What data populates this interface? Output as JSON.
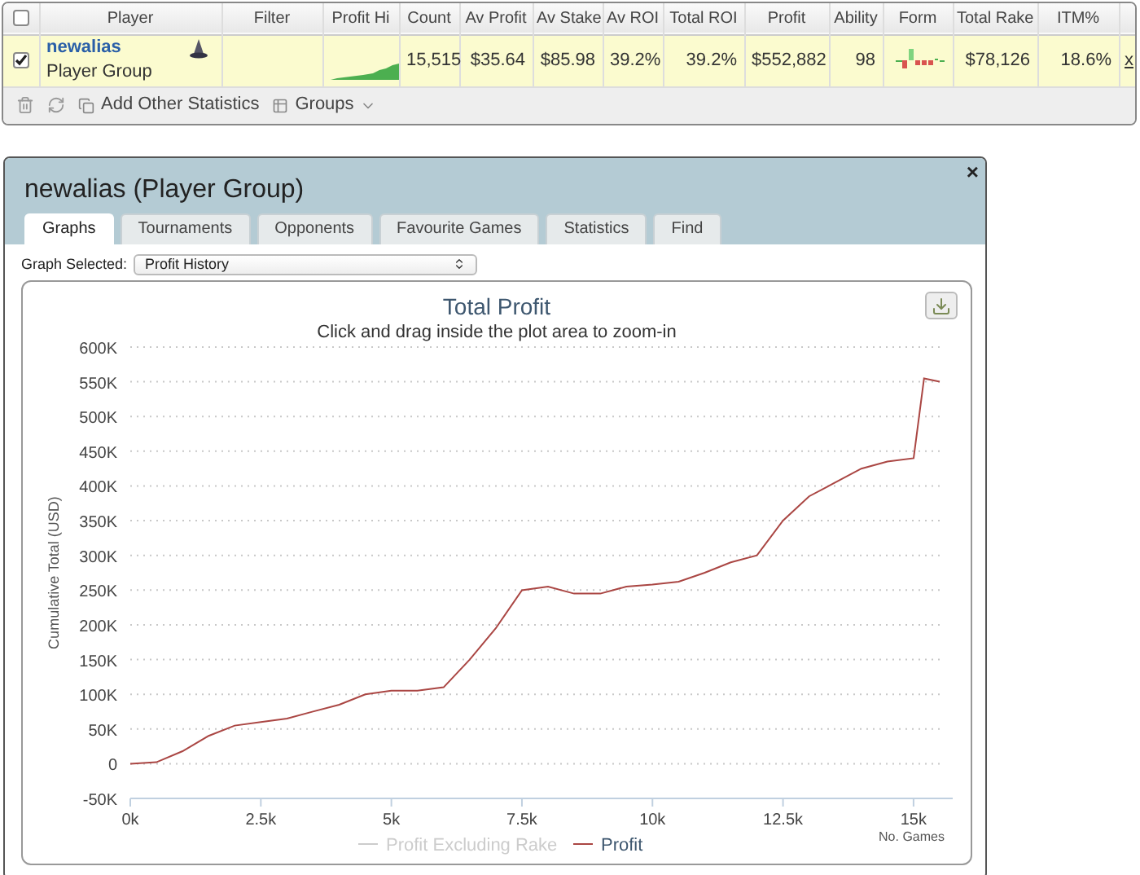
{
  "table": {
    "select_all": {
      "checked": false
    },
    "columns": [
      {},
      {
        "label": "Player"
      },
      {
        "label": "Filter"
      },
      {
        "label": "Profit Hi"
      },
      {
        "label": "Count"
      },
      {
        "label": "Av Profit"
      },
      {
        "label": "Av Stake"
      },
      {
        "label": "Av ROI"
      },
      {
        "label": "Total ROI"
      },
      {
        "label": "Profit"
      },
      {
        "label": "Ability"
      },
      {
        "label": "Form"
      },
      {
        "label": "Total Rake"
      },
      {
        "label": "ITM%"
      },
      {}
    ],
    "rows": [
      {
        "checked": true,
        "name": "newalias",
        "subtitle": "Player Group",
        "count": "15,515",
        "av_profit": "$35.64",
        "av_stake": "$85.98",
        "av_roi": "39.2%",
        "total_roi": "39.2%",
        "profit": "$552,882",
        "ability": "98",
        "total_rake": "$78,126",
        "itm": "18.6%",
        "remove": "x"
      }
    ]
  },
  "toolbar": {
    "items": [
      {
        "kind": "trash"
      },
      {
        "kind": "refresh"
      },
      {
        "kind": "add",
        "label": "Add Other Statistics"
      },
      {
        "kind": "groups",
        "label": "Groups"
      }
    ]
  },
  "dialog": {
    "title": "newalias (Player Group)",
    "close": "×",
    "tabs": [
      {
        "label": "Graphs",
        "selected": true
      },
      {
        "label": "Tournaments",
        "selected": false
      },
      {
        "label": "Opponents",
        "selected": false
      },
      {
        "label": "Favourite Games",
        "selected": false
      },
      {
        "label": "Statistics",
        "selected": false
      },
      {
        "label": "Find",
        "selected": false
      }
    ],
    "graph_select": {
      "label": "Graph Selected:",
      "value": "Profit History"
    },
    "hidden_legend": [
      {
        "label": "Profit Excluding Rake",
        "color": "#cccccc"
      }
    ],
    "chart_data": {
      "type": "line",
      "title": "Total Profit",
      "subtitle": "Click and drag inside the plot area to zoom-in",
      "xlabel": "No. Games",
      "ylabel": "Cumulative Total (USD)",
      "grid": true,
      "x": [
        0,
        500,
        1000,
        1500,
        2000,
        2500,
        3000,
        3500,
        4000,
        4500,
        5000,
        5500,
        6000,
        6500,
        7000,
        7500,
        8000,
        8500,
        9000,
        9500,
        10000,
        10500,
        11000,
        11500,
        12000,
        12500,
        13000,
        13500,
        14000,
        14500,
        15000,
        15200,
        15500
      ],
      "series": [
        {
          "name": "Profit",
          "color": "#aa4643",
          "values": [
            0,
            2000,
            18000,
            40000,
            55000,
            60000,
            65000,
            75000,
            85000,
            100000,
            105000,
            105000,
            110000,
            150000,
            195000,
            250000,
            255000,
            245000,
            245000,
            255000,
            258000,
            262000,
            275000,
            290000,
            300000,
            350000,
            385000,
            405000,
            425000,
            435000,
            440000,
            555000,
            550000
          ]
        }
      ],
      "xlim": [
        0,
        15750
      ],
      "ylim": [
        -50000,
        600000
      ],
      "xticks": [
        {
          "value": 0,
          "label": "0k"
        },
        {
          "value": 2500,
          "label": "2.5k"
        },
        {
          "value": 5000,
          "label": "5k"
        },
        {
          "value": 7500,
          "label": "7.5k"
        },
        {
          "value": 10000,
          "label": "10k"
        },
        {
          "value": 12500,
          "label": "12.5k"
        },
        {
          "value": 15000,
          "label": "15k"
        }
      ],
      "yticks": [
        {
          "value": -50000,
          "label": "-50K"
        },
        {
          "value": 0,
          "label": "0"
        },
        {
          "value": 50000,
          "label": "50K"
        },
        {
          "value": 100000,
          "label": "100K"
        },
        {
          "value": 150000,
          "label": "150K"
        },
        {
          "value": 200000,
          "label": "200K"
        },
        {
          "value": 250000,
          "label": "250K"
        },
        {
          "value": 300000,
          "label": "300K"
        },
        {
          "value": 350000,
          "label": "350K"
        },
        {
          "value": 400000,
          "label": "400K"
        },
        {
          "value": 450000,
          "label": "450K"
        },
        {
          "value": 500000,
          "label": "500K"
        },
        {
          "value": 550000,
          "label": "550K"
        },
        {
          "value": 600000,
          "label": "600K"
        }
      ]
    }
  }
}
